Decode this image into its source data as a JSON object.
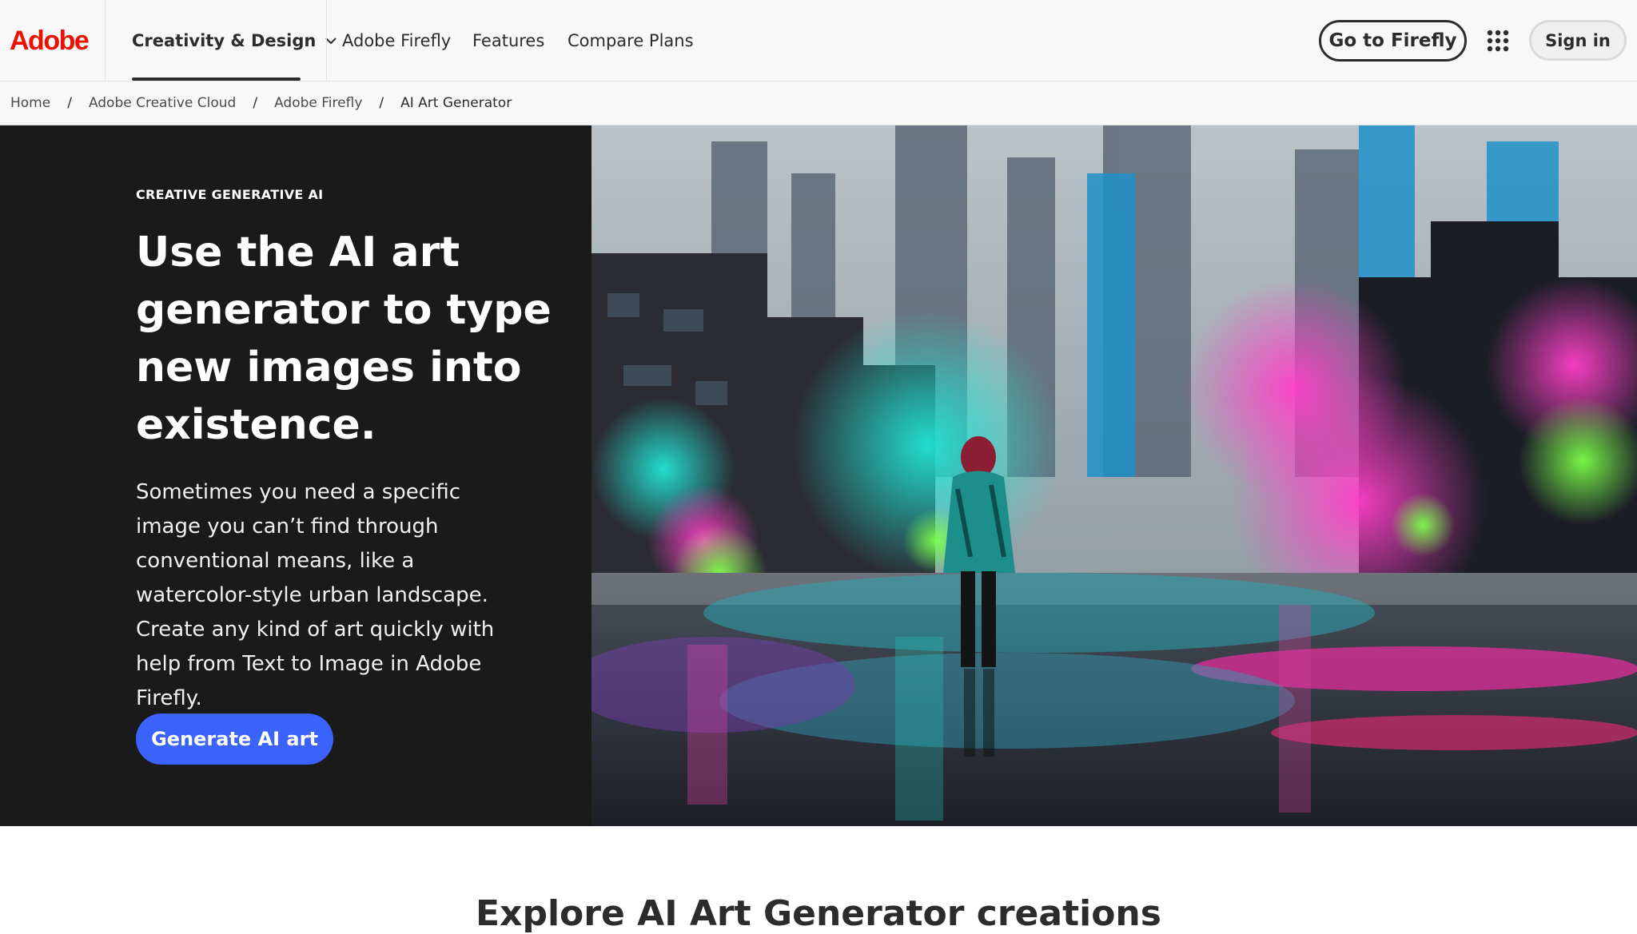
{
  "brand": {
    "name": "Adobe",
    "color": "#eb1000"
  },
  "nav": {
    "main_item": "Creativity & Design",
    "links": [
      "Adobe Firefly",
      "Features",
      "Compare Plans"
    ],
    "go_to_firefly": "Go to Firefly",
    "sign_in": "Sign in",
    "apps_icon": "app-grid-icon"
  },
  "breadcrumb": [
    "Home",
    "Adobe Creative Cloud",
    "Adobe Firefly",
    "AI Art Generator"
  ],
  "hero": {
    "eyebrow": "CREATIVE GENERATIVE AI",
    "headline": "Use the AI art generator to type new images into existence.",
    "body": "Sometimes you need a specific image you can’t find through conventional means, like a watercolor-style urban landscape. Create any kind of art quickly with help from Text to Image in Adobe Firefly.",
    "cta": "Generate AI art",
    "cta_color": "#3b63fb"
  },
  "next_section": {
    "title": "Explore AI Art Generator creations"
  }
}
